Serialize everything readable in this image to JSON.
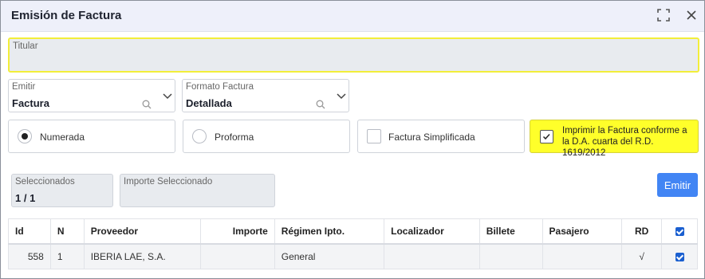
{
  "dialog": {
    "title": "Emisión de Factura"
  },
  "titular": {
    "label": "Titular",
    "value": ""
  },
  "emitir_field": {
    "label": "Emitir",
    "value": "Factura"
  },
  "formato_field": {
    "label": "Formato Factura",
    "value": "Detallada"
  },
  "options": {
    "numerada": "Numerada",
    "proforma": "Proforma",
    "simplificada": "Factura Simplificada",
    "imprimir": "Imprimir la Factura conforme a la D.A. cuarta del R.D. 1619/2012"
  },
  "selected_field": {
    "label": "Seleccionados",
    "value": "1 / 1"
  },
  "importe_field": {
    "label": "Importe Seleccionado",
    "value": ""
  },
  "emitir_button": "Emitir",
  "table": {
    "headers": [
      "Id",
      "N",
      "Proveedor",
      "Importe",
      "Régimen Ipto.",
      "Localizador",
      "Billete",
      "Pasajero",
      "RD"
    ],
    "rows": [
      {
        "id": "558",
        "n": "1",
        "proveedor": "IBERIA LAE, S.A.",
        "importe": "",
        "regimen": "General",
        "localizador": "",
        "billete": "",
        "pasajero": "",
        "rd": "√",
        "checked": true
      }
    ]
  },
  "colors": {
    "accent": "#4285f4",
    "highlight": "#ffff2a",
    "header_bg": "#eef0fa"
  }
}
